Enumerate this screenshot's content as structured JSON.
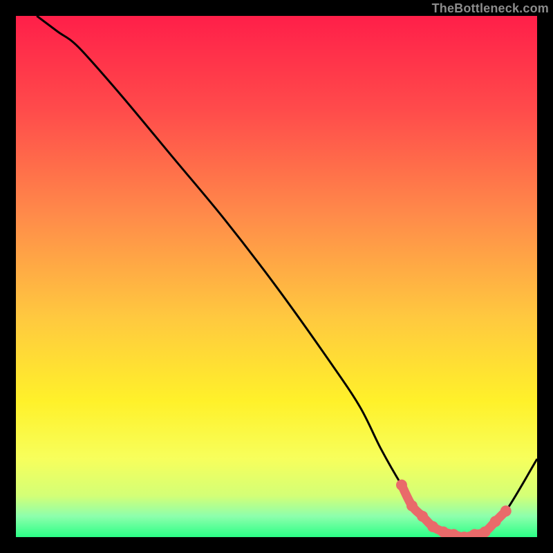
{
  "attribution": "TheBottleneck.com",
  "chart_data": {
    "type": "line",
    "title": "",
    "xlabel": "",
    "ylabel": "",
    "xlim": [
      0,
      100
    ],
    "ylim": [
      0,
      100
    ],
    "curve_series": {
      "name": "bottleneck-curve",
      "x": [
        4,
        8,
        12,
        20,
        30,
        40,
        50,
        60,
        66,
        70,
        74,
        78,
        82,
        86,
        90,
        94,
        100
      ],
      "y": [
        100,
        97,
        94,
        85,
        73,
        61,
        48,
        34,
        25,
        17,
        10,
        4,
        1,
        0,
        1,
        5,
        15
      ]
    },
    "highlight_series": {
      "name": "optimal-region",
      "x": [
        74,
        76,
        78,
        80,
        82,
        84,
        86,
        88,
        90,
        92,
        94
      ],
      "y": [
        10,
        6,
        4,
        2,
        1,
        0.5,
        0,
        0.5,
        1,
        3,
        5
      ]
    },
    "background_gradient_stops": [
      {
        "offset": 0,
        "color": "#ff1f49"
      },
      {
        "offset": 18,
        "color": "#ff4b4b"
      },
      {
        "offset": 38,
        "color": "#ff8a4a"
      },
      {
        "offset": 58,
        "color": "#ffc93f"
      },
      {
        "offset": 74,
        "color": "#fff12a"
      },
      {
        "offset": 85,
        "color": "#f7ff5c"
      },
      {
        "offset": 92,
        "color": "#d4ff76"
      },
      {
        "offset": 96,
        "color": "#8dffac"
      },
      {
        "offset": 100,
        "color": "#2bff86"
      }
    ],
    "colors": {
      "curve": "#000000",
      "highlight": "#e96a6a",
      "frame": "#000000"
    }
  }
}
